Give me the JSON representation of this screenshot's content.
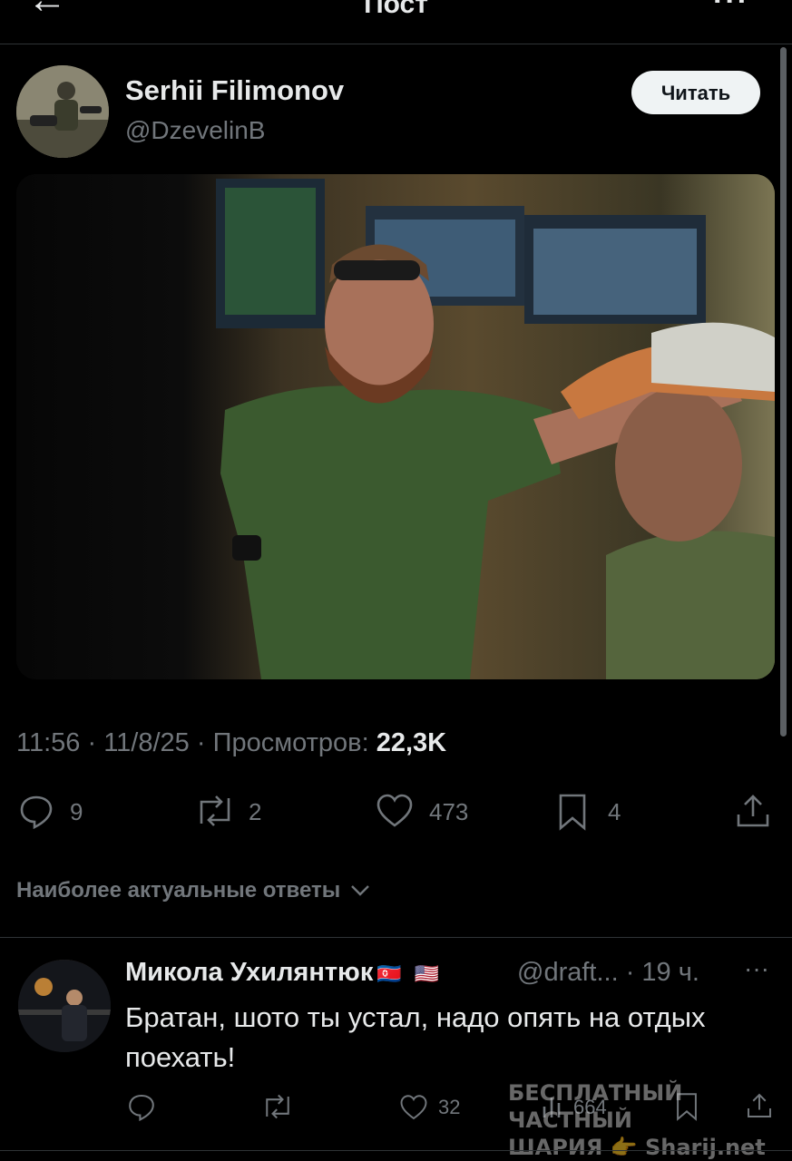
{
  "header": {
    "back_icon": "arrow-left-icon",
    "title": "Пост",
    "more_icon": "ellipsis-icon"
  },
  "post": {
    "author": {
      "name": "Serhii Filimonov",
      "handle": "@DzevelinB"
    },
    "follow_label": "Читать",
    "meta": {
      "time": "11:56",
      "date": "11/8/25",
      "views_label": "Просмотров:",
      "views": "22,3K"
    },
    "actions": {
      "replies": "9",
      "reposts": "2",
      "likes": "473",
      "bookmarks": "4"
    }
  },
  "replies_section": {
    "sort_label": "Наиболее актуальные ответы"
  },
  "reply": {
    "name": "Микола Ухилянтюк",
    "flags": [
      "🇰🇵",
      "🇺🇸"
    ],
    "handle": "@draft...",
    "time": "· 19 ч.",
    "more": "···",
    "text": "Братан, шото ты устал, надо опять на отдых поехать!",
    "actions": {
      "replies": "",
      "reposts": "",
      "likes": "32",
      "views": "664"
    }
  },
  "watermark": {
    "line1": "БЕСПЛАТНЫЙ ЧАСТНЫЙ",
    "line2": "ШАРИЯ 👉 Sharij.net"
  },
  "colors": {
    "background": "#000000",
    "text": "#e7e9ea",
    "muted": "#71767b",
    "divider": "#2f3336",
    "button": "#eff3f4"
  }
}
